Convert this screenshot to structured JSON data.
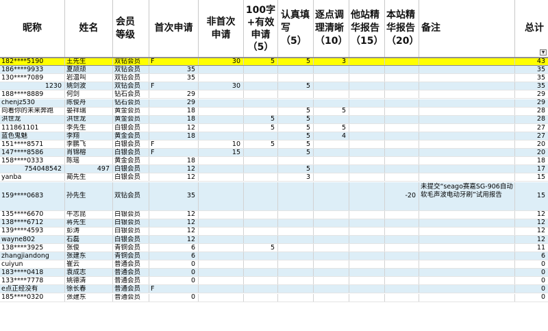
{
  "headers": {
    "nick": "昵称",
    "name": "姓名",
    "level": "会员\n等级",
    "first": "首次申请",
    "nonfirst": "非首次\n申请",
    "valid100": "100字\n+有效\n申请\n（5）",
    "careful": "认真填\n写\n（5）",
    "clear": "逐点调\n理清晰\n（10）",
    "other": "他站精\n华报告\n（15）",
    "ours": "本站精\n华报告\n（20）",
    "note": "备注",
    "total": "总计"
  },
  "filter_icon": "dropdown-arrow-icon",
  "rows": [
    {
      "nick": "182****5190",
      "name": "王先生",
      "level": "双钻会员",
      "first": "F",
      "nonfirst": "30",
      "valid100": "5",
      "careful": "5",
      "clear": "3",
      "other": "",
      "ours": "",
      "note": "",
      "total": "43",
      "highlight": true
    },
    {
      "nick": "186****9933",
      "name": "夏颉颃",
      "level": "双钻会员",
      "first": "35",
      "nonfirst": "",
      "valid100": "",
      "careful": "",
      "clear": "",
      "other": "",
      "ours": "",
      "note": "",
      "total": "35"
    },
    {
      "nick": "130****7089",
      "name": "岩温叫",
      "level": "双钻会员",
      "first": "35",
      "nonfirst": "",
      "valid100": "",
      "careful": "",
      "clear": "",
      "other": "",
      "ours": "",
      "note": "",
      "total": "35"
    },
    {
      "nick": "1230",
      "name": "姚剑波",
      "level": "双钻会员",
      "first": "F",
      "nonfirst": "30",
      "valid100": "",
      "careful": "5",
      "clear": "",
      "other": "",
      "ours": "",
      "note": "",
      "total": "35",
      "nickRight": true
    },
    {
      "nick": "188****8889",
      "name": "何剑",
      "level": "钻石会员",
      "first": "29",
      "nonfirst": "",
      "valid100": "",
      "careful": "",
      "clear": "",
      "other": "",
      "ours": "",
      "note": "",
      "total": "29"
    },
    {
      "nick": "chenjz530",
      "name": "陈俊舟",
      "level": "钻石会员",
      "first": "29",
      "nonfirst": "",
      "valid100": "",
      "careful": "",
      "clear": "",
      "other": "",
      "ours": "",
      "note": "",
      "total": "29"
    },
    {
      "nick": "向着你的未来奔跑",
      "name": "晏祥瑞",
      "level": "黄金会员",
      "first": "18",
      "nonfirst": "",
      "valid100": "",
      "careful": "5",
      "clear": "5",
      "other": "",
      "ours": "",
      "note": "",
      "total": "28"
    },
    {
      "nick": "洪世龙",
      "name": "洪世龙",
      "level": "黄金会员",
      "first": "18",
      "nonfirst": "",
      "valid100": "5",
      "careful": "5",
      "clear": "",
      "other": "",
      "ours": "",
      "note": "",
      "total": "28"
    },
    {
      "nick": "111861101",
      "name": "李先生",
      "level": "白银会员",
      "first": "12",
      "nonfirst": "",
      "valid100": "5",
      "careful": "5",
      "clear": "5",
      "other": "",
      "ours": "",
      "note": "",
      "total": "27"
    },
    {
      "nick": "蓝色鬼魅",
      "name": "李翔",
      "level": "黄金会员",
      "first": "18",
      "nonfirst": "",
      "valid100": "",
      "careful": "5",
      "clear": "4",
      "other": "",
      "ours": "",
      "note": "",
      "total": "27"
    },
    {
      "nick": "151****8571",
      "name": "李鹏飞",
      "level": "白银会员",
      "first": "F",
      "nonfirst": "10",
      "valid100": "5",
      "careful": "5",
      "clear": "",
      "other": "",
      "ours": "",
      "note": "",
      "total": "20"
    },
    {
      "nick": "147****8586",
      "name": "肖锦榕",
      "level": "白银会员",
      "first": "F",
      "nonfirst": "15",
      "valid100": "",
      "careful": "5",
      "clear": "",
      "other": "",
      "ours": "",
      "note": "",
      "total": "20"
    },
    {
      "nick": "158****0333",
      "name": "陈瑶",
      "level": "黄金会员",
      "first": "18",
      "nonfirst": "",
      "valid100": "",
      "careful": "",
      "clear": "",
      "other": "",
      "ours": "",
      "note": "",
      "total": "18"
    },
    {
      "nick": "754048542",
      "name": "497",
      "level": "白银会员",
      "first": "12",
      "nonfirst": "",
      "valid100": "",
      "careful": "5",
      "clear": "",
      "other": "",
      "ours": "",
      "note": "",
      "total": "17",
      "nickRight": true,
      "nameRight": true
    },
    {
      "nick": "yanba",
      "name": "蔺先生",
      "level": "白银会员",
      "first": "12",
      "nonfirst": "",
      "valid100": "",
      "careful": "3",
      "clear": "",
      "other": "",
      "ours": "",
      "note": "",
      "total": "15"
    },
    {
      "nick": "159****0683",
      "name": "孙先生",
      "level": "双钻会员",
      "first": "35",
      "nonfirst": "",
      "valid100": "",
      "careful": "",
      "clear": "",
      "other": "",
      "ours": "-20",
      "note": "未提交“seago赛嘉SG-906自动软毛声波电动牙刷”试用报告",
      "total": "15",
      "tall": true
    },
    {
      "nick": "135****6670",
      "name": "牛志昆",
      "level": "白银会员",
      "first": "12",
      "nonfirst": "",
      "valid100": "",
      "careful": "",
      "clear": "",
      "other": "",
      "ours": "",
      "note": "",
      "total": "12"
    },
    {
      "nick": "138****6712",
      "name": "蒋先生",
      "level": "白银会员",
      "first": "12",
      "nonfirst": "",
      "valid100": "",
      "careful": "",
      "clear": "",
      "other": "",
      "ours": "",
      "note": "",
      "total": "12"
    },
    {
      "nick": "139****4593",
      "name": "彭涛",
      "level": "白银会员",
      "first": "12",
      "nonfirst": "",
      "valid100": "",
      "careful": "",
      "clear": "",
      "other": "",
      "ours": "",
      "note": "",
      "total": "12"
    },
    {
      "nick": "wayne802",
      "name": "石磊",
      "level": "白银会员",
      "first": "12",
      "nonfirst": "",
      "valid100": "",
      "careful": "",
      "clear": "",
      "other": "",
      "ours": "",
      "note": "",
      "total": "12"
    },
    {
      "nick": "138****3925",
      "name": "张俊",
      "level": "青铜会员",
      "first": "6",
      "nonfirst": "",
      "valid100": "5",
      "careful": "",
      "clear": "",
      "other": "",
      "ours": "",
      "note": "",
      "total": "11"
    },
    {
      "nick": "zhangjiandong",
      "name": "张建东",
      "level": "青铜会员",
      "first": "6",
      "nonfirst": "",
      "valid100": "",
      "careful": "",
      "clear": "",
      "other": "",
      "ours": "",
      "note": "",
      "total": "6"
    },
    {
      "nick": "cuiyun",
      "name": "崔云",
      "level": "普通会员",
      "first": "0",
      "nonfirst": "",
      "valid100": "",
      "careful": "",
      "clear": "",
      "other": "",
      "ours": "",
      "note": "",
      "total": "0"
    },
    {
      "nick": "183****0418",
      "name": "袁成志",
      "level": "普通会员",
      "first": "0",
      "nonfirst": "",
      "valid100": "",
      "careful": "",
      "clear": "",
      "other": "",
      "ours": "",
      "note": "",
      "total": "0"
    },
    {
      "nick": "133****7778",
      "name": "姚德清",
      "level": "普通会员",
      "first": "0",
      "nonfirst": "",
      "valid100": "",
      "careful": "",
      "clear": "",
      "other": "",
      "ours": "",
      "note": "",
      "total": "0"
    },
    {
      "nick": "e点正经没有",
      "name": "徐长春",
      "level": "普通会员",
      "first": "F",
      "nonfirst": "",
      "valid100": "",
      "careful": "",
      "clear": "",
      "other": "",
      "ours": "",
      "note": "",
      "total": "0"
    },
    {
      "nick": "185****0320",
      "name": "张建东",
      "level": "普通会员",
      "first": "0",
      "nonfirst": "",
      "valid100": "",
      "careful": "",
      "clear": "",
      "other": "",
      "ours": "",
      "note": "",
      "total": "0"
    }
  ]
}
